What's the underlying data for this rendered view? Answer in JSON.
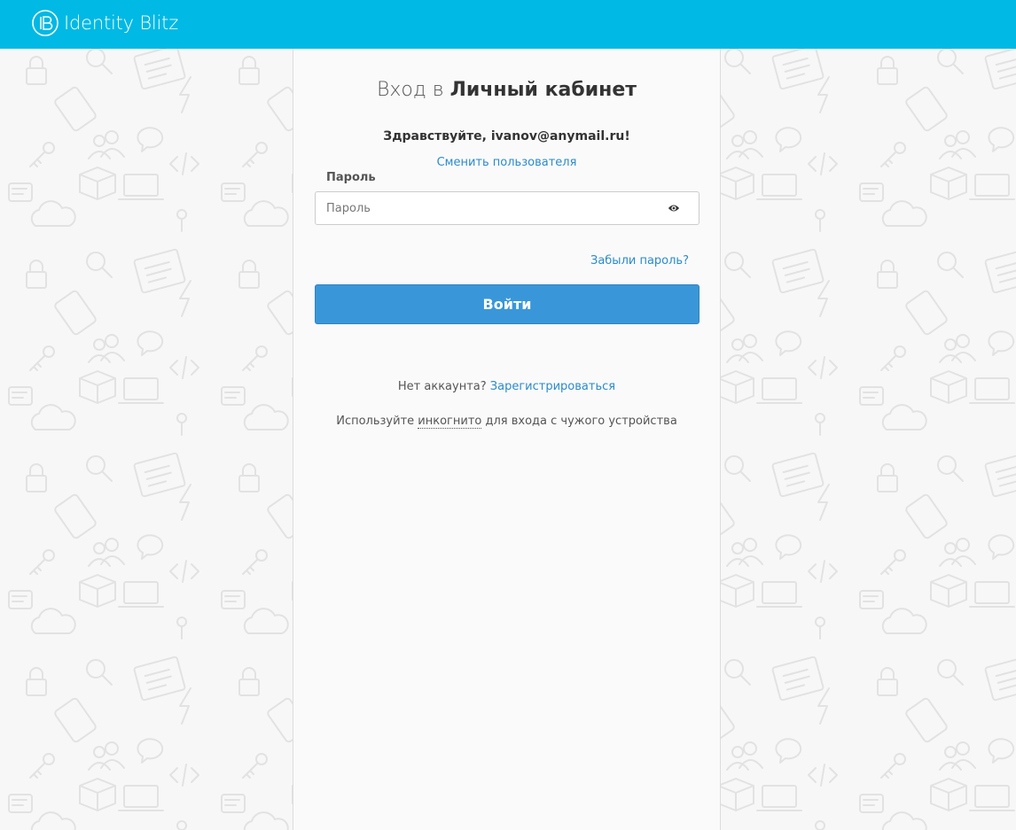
{
  "colors": {
    "header_bg": "#00b9e4",
    "link": "#2b8bcb",
    "button_bg": "#3997d9",
    "page_bg": "#f7f7f7",
    "pattern_stroke": "#e4e4e4"
  },
  "header": {
    "logo_text": "Identity Blitz",
    "logo_icon": "ib-monogram-icon"
  },
  "login": {
    "title_prefix": "Вход в",
    "title_bold": "Личный кабинет",
    "greeting": "Здравствуйте, ivanov@anymail.ru!",
    "switch_user": "Сменить пользователя",
    "password_label": "Пароль",
    "password_placeholder": "Пароль",
    "password_value": "",
    "show_password_icon": "eye-icon",
    "forgot_password": "Забыли пароль?",
    "submit_label": "Войти"
  },
  "footer": {
    "no_account_text": "Нет аккаунта?",
    "register_link": "Зарегистрироваться",
    "incognito_prefix": "Используйте",
    "incognito_word": "инкогнито",
    "incognito_suffix": "для входа с чужого устройства"
  }
}
